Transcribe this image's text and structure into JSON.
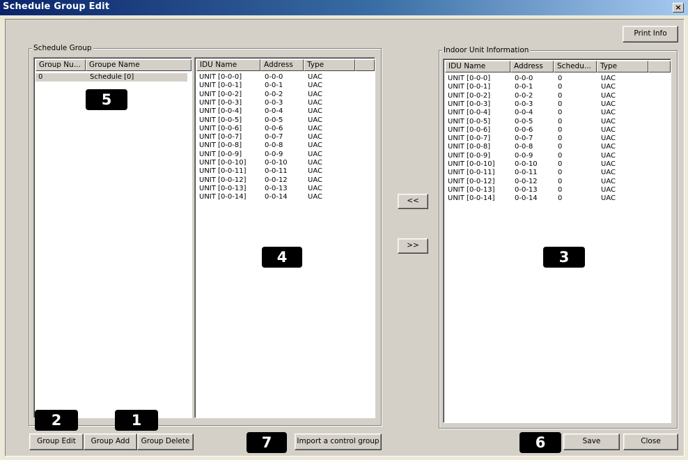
{
  "window": {
    "title": "Schedule Group Edit",
    "close_glyph": "×"
  },
  "print_info_label": "Print Info",
  "schedule_group": {
    "label": "Schedule Group",
    "groups_list": {
      "columns": [
        "Group Nu...",
        "Groupe Name"
      ],
      "rows": [
        {
          "num": "0",
          "name": "Schedule [0]"
        }
      ]
    },
    "idu_list": {
      "columns": [
        "IDU Name",
        "Address",
        "Type"
      ],
      "rows": [
        {
          "name": "UNIT [0-0-0]",
          "address": "0-0-0",
          "type": "UAC"
        },
        {
          "name": "UNIT [0-0-1]",
          "address": "0-0-1",
          "type": "UAC"
        },
        {
          "name": "UNIT [0-0-2]",
          "address": "0-0-2",
          "type": "UAC"
        },
        {
          "name": "UNIT [0-0-3]",
          "address": "0-0-3",
          "type": "UAC"
        },
        {
          "name": "UNIT [0-0-4]",
          "address": "0-0-4",
          "type": "UAC"
        },
        {
          "name": "UNIT [0-0-5]",
          "address": "0-0-5",
          "type": "UAC"
        },
        {
          "name": "UNIT [0-0-6]",
          "address": "0-0-6",
          "type": "UAC"
        },
        {
          "name": "UNIT [0-0-7]",
          "address": "0-0-7",
          "type": "UAC"
        },
        {
          "name": "UNIT [0-0-8]",
          "address": "0-0-8",
          "type": "UAC"
        },
        {
          "name": "UNIT [0-0-9]",
          "address": "0-0-9",
          "type": "UAC"
        },
        {
          "name": "UNIT [0-0-10]",
          "address": "0-0-10",
          "type": "UAC"
        },
        {
          "name": "UNIT [0-0-11]",
          "address": "0-0-11",
          "type": "UAC"
        },
        {
          "name": "UNIT [0-0-12]",
          "address": "0-0-12",
          "type": "UAC"
        },
        {
          "name": "UNIT [0-0-13]",
          "address": "0-0-13",
          "type": "UAC"
        },
        {
          "name": "UNIT [0-0-14]",
          "address": "0-0-14",
          "type": "UAC"
        }
      ]
    },
    "buttons": {
      "group_edit": "Group Edit",
      "group_add": "Group Add",
      "group_delete": "Group Delete",
      "import": "Import a control group"
    }
  },
  "transfer": {
    "left": "<<",
    "right": ">>"
  },
  "indoor_unit_info": {
    "label": "Indoor Unit Information",
    "columns": [
      "IDU Name",
      "Address",
      "Schedu...",
      "Type"
    ],
    "rows": [
      {
        "name": "UNIT [0-0-0]",
        "address": "0-0-0",
        "schedule": "0",
        "type": "UAC"
      },
      {
        "name": "UNIT [0-0-1]",
        "address": "0-0-1",
        "schedule": "0",
        "type": "UAC"
      },
      {
        "name": "UNIT [0-0-2]",
        "address": "0-0-2",
        "schedule": "0",
        "type": "UAC"
      },
      {
        "name": "UNIT [0-0-3]",
        "address": "0-0-3",
        "schedule": "0",
        "type": "UAC"
      },
      {
        "name": "UNIT [0-0-4]",
        "address": "0-0-4",
        "schedule": "0",
        "type": "UAC"
      },
      {
        "name": "UNIT [0-0-5]",
        "address": "0-0-5",
        "schedule": "0",
        "type": "UAC"
      },
      {
        "name": "UNIT [0-0-6]",
        "address": "0-0-6",
        "schedule": "0",
        "type": "UAC"
      },
      {
        "name": "UNIT [0-0-7]",
        "address": "0-0-7",
        "schedule": "0",
        "type": "UAC"
      },
      {
        "name": "UNIT [0-0-8]",
        "address": "0-0-8",
        "schedule": "0",
        "type": "UAC"
      },
      {
        "name": "UNIT [0-0-9]",
        "address": "0-0-9",
        "schedule": "0",
        "type": "UAC"
      },
      {
        "name": "UNIT [0-0-10]",
        "address": "0-0-10",
        "schedule": "0",
        "type": "UAC"
      },
      {
        "name": "UNIT [0-0-11]",
        "address": "0-0-11",
        "schedule": "0",
        "type": "UAC"
      },
      {
        "name": "UNIT [0-0-12]",
        "address": "0-0-12",
        "schedule": "0",
        "type": "UAC"
      },
      {
        "name": "UNIT [0-0-13]",
        "address": "0-0-13",
        "schedule": "0",
        "type": "UAC"
      },
      {
        "name": "UNIT [0-0-14]",
        "address": "0-0-14",
        "schedule": "0",
        "type": "UAC"
      }
    ]
  },
  "bottom_buttons": {
    "save": "Save",
    "close": "Close"
  },
  "callouts": {
    "c1": "1",
    "c2": "2",
    "c3": "3",
    "c4": "4",
    "c5": "5",
    "c6": "6",
    "c7": "7"
  }
}
